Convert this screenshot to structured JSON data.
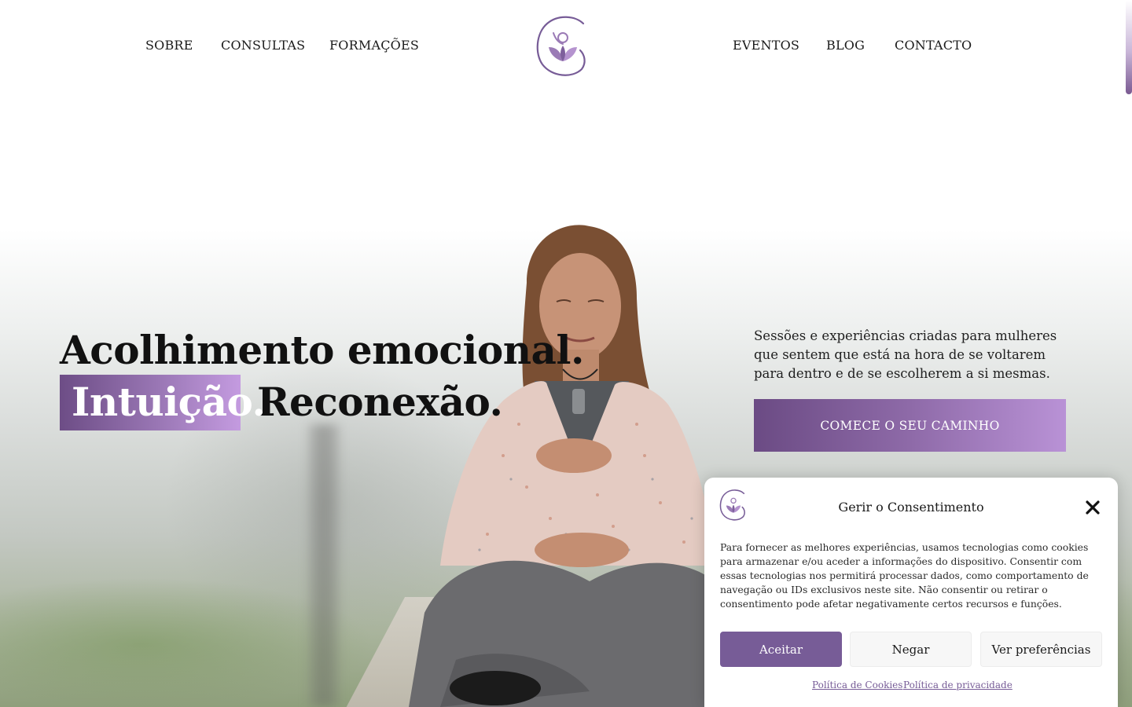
{
  "nav": {
    "left": [
      "SOBRE",
      "CONSULTAS",
      "FORMAÇÕES"
    ],
    "right": [
      "EVENTOS",
      "BLOG",
      "CONTACTO"
    ]
  },
  "logo_icon": "lotus-figure-logo-icon",
  "hero": {
    "headline_line1": "Acolhimento emocional.",
    "headline_highlight": "Intuição.",
    "headline_line2": "Reconexão.",
    "intro": "Sessões e experiências criadas para mulheres que sentem que está na hora de se voltarem para dentro e de se escolherem a si mesmas.",
    "cta": "COMECE O SEU CAMINHO"
  },
  "consent": {
    "title": "Gerir o Consentimento",
    "close_icon": "close-icon",
    "text": "Para fornecer as melhores experiências, usamos tecnologias como cookies para armazenar e/ou aceder a informações do dispositivo. Consentir com essas tecnologias nos permitirá processar dados, como comportamento de navegação ou IDs exclusivos neste site. Não consentir ou retirar o consentimento pode afetar negativamente certos recursos e funções.",
    "accept": "Aceitar",
    "deny": "Negar",
    "preferences": "Ver preferências",
    "cookie_policy": "Política de Cookies",
    "privacy_policy": "Política de privacidade"
  },
  "colors": {
    "brand_purple": "#775c97",
    "gradient_start": "#6b4b84",
    "gradient_end": "#c49be0",
    "text": "#1a1a1a"
  }
}
